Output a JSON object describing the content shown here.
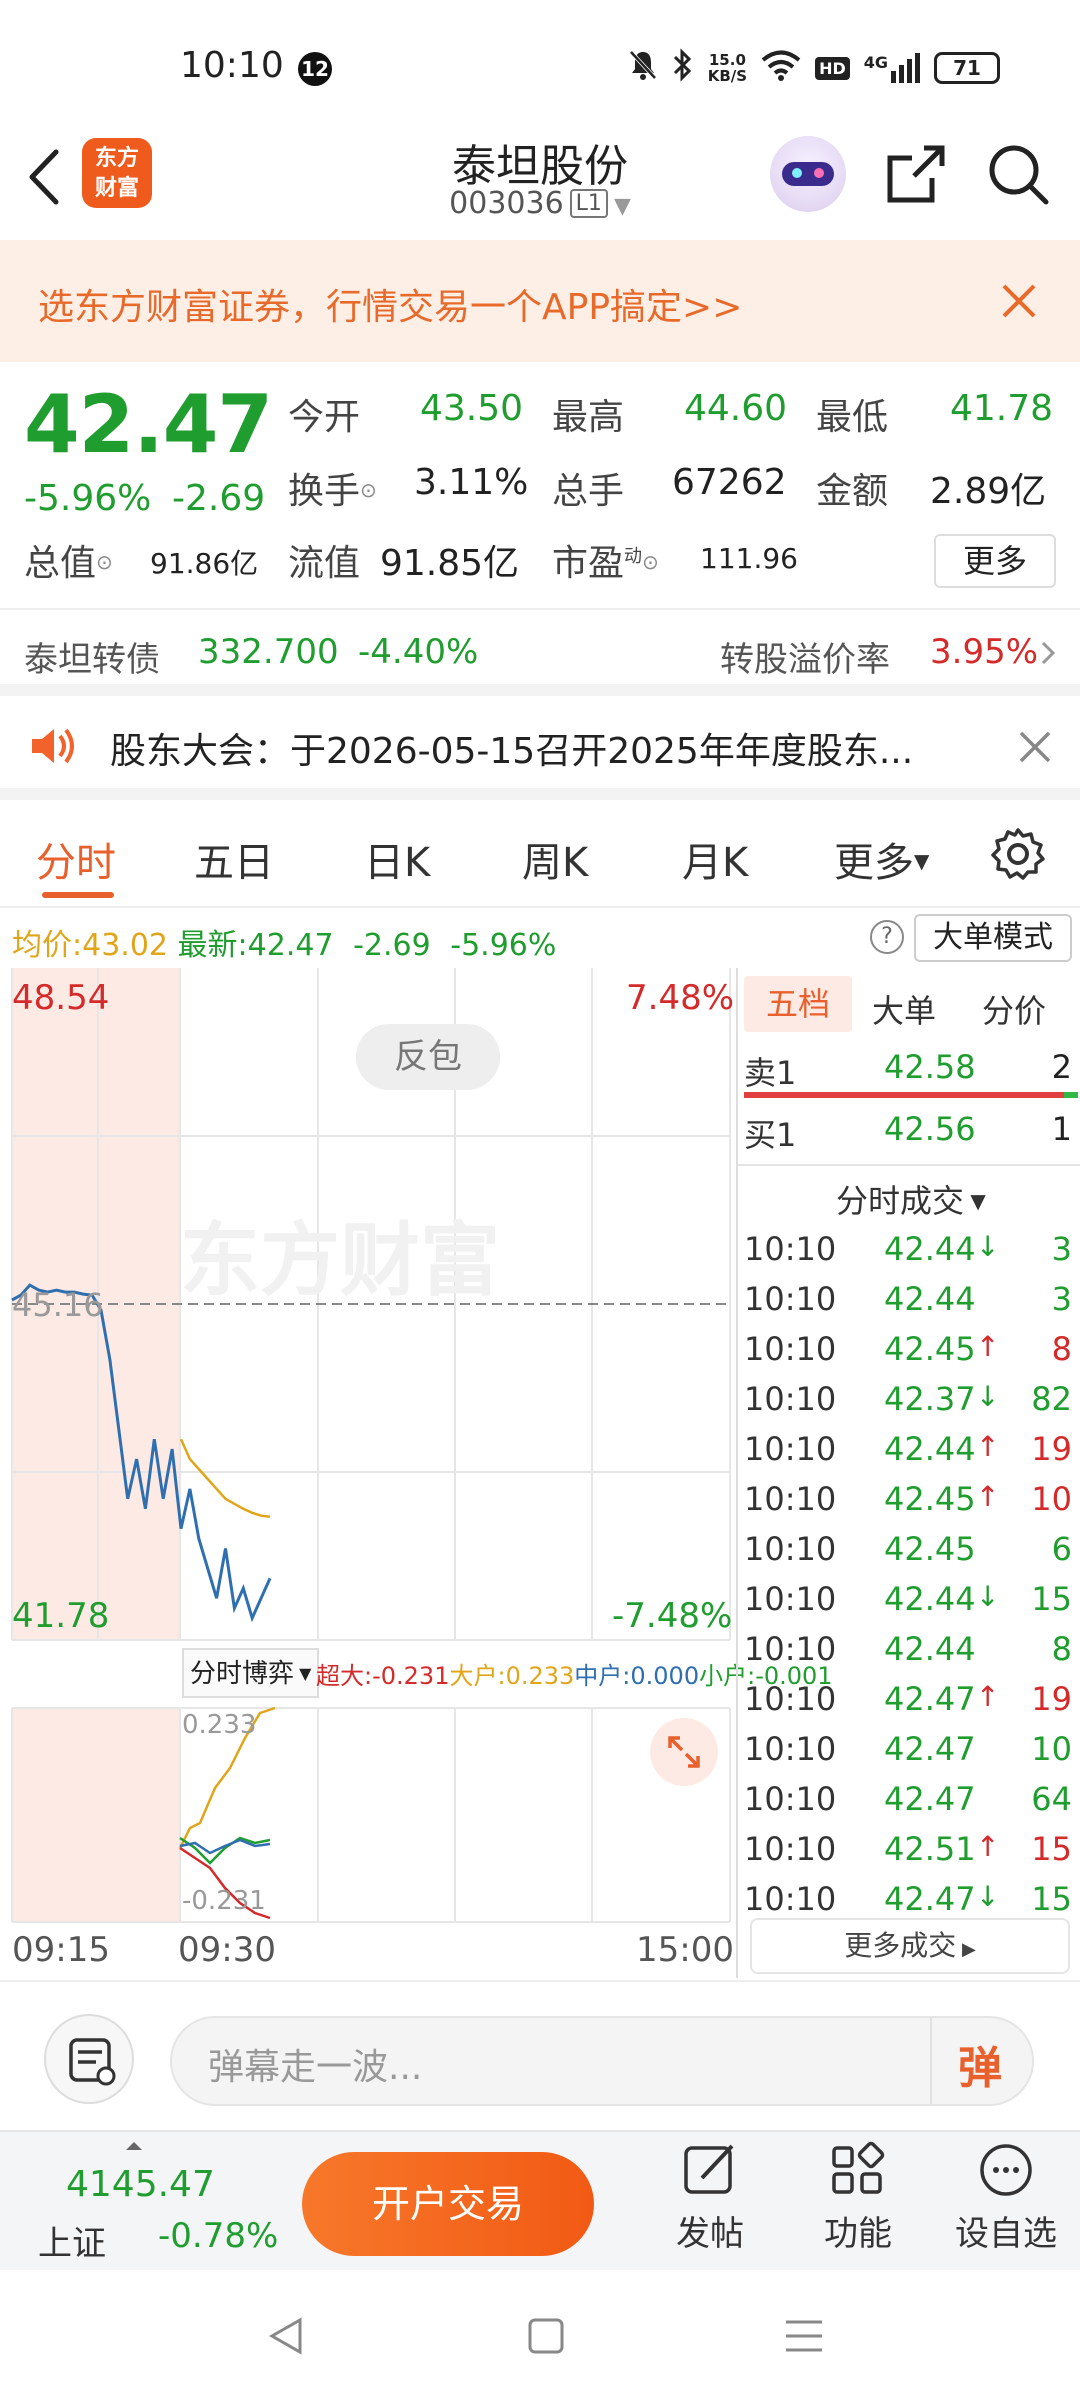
{
  "status_bar": {
    "time": "10:10",
    "notification_count": "12",
    "net_speed_value": "15.0",
    "net_speed_unit": "KB/S",
    "hd": "HD",
    "signal": "4G",
    "battery": "71"
  },
  "header": {
    "logo_text": "东方财富",
    "title": "泰坦股份",
    "code": "003036",
    "code_tag": "L1"
  },
  "banner": {
    "text": "选东方财富证券，行情交易一个APP搞定>>"
  },
  "quote": {
    "price": "42.47",
    "change_pct": "-5.96%",
    "change": "-2.69",
    "open_label": "今开",
    "open": "43.50",
    "high_label": "最高",
    "high": "44.60",
    "low_label": "最低",
    "low": "41.78",
    "turnover_label": "换手",
    "turnover": "3.11%",
    "volume_label": "总手",
    "volume": "67262",
    "amount_label": "金额",
    "amount": "2.89亿",
    "mktcap_label": "总值",
    "mktcap": "91.86亿",
    "float_label": "流值",
    "float": "91.85亿",
    "pe_label": "市盈",
    "pe_sup": "动",
    "pe": "111.96",
    "more_button": "更多"
  },
  "bond": {
    "name": "泰坦转债",
    "price": "332.700",
    "change": "-4.40%",
    "premium_label": "转股溢价率",
    "premium": "3.95%"
  },
  "notice": {
    "text": "股东大会：于2026-05-15召开2025年年度股东..."
  },
  "tabs": [
    "分时",
    "五日",
    "日K",
    "周K",
    "月K",
    "更多"
  ],
  "indicators": {
    "avg_label": "均价:",
    "avg": "43.02",
    "latest_label": "最新:",
    "latest": "42.47",
    "change": "-2.69",
    "change_pct": "-5.96%",
    "mode_button": "大单模式"
  },
  "chart": {
    "top_price": "48.54",
    "mid_price": "45.16",
    "bottom_price": "41.78",
    "top_pct": "7.48%",
    "bottom_pct": "-7.48%",
    "pattern_label": "反包",
    "watermark": "东方财富",
    "time_start": "09:15",
    "time_mid": "09:30",
    "time_end": "15:00"
  },
  "flow": {
    "selector": "分时博弈",
    "super_label": "超大:",
    "super": "-0.231",
    "big_label": "大户:",
    "big": "0.233",
    "mid_label": "中户:",
    "mid": "0.000",
    "small_label": "小户:",
    "small": "-0.001",
    "axis_top": "0.233",
    "axis_bottom": "-0.231"
  },
  "chart_data": {
    "type": "line",
    "series": [
      {
        "name": "",
        "values": [
          45.2,
          45.25,
          45.35,
          45.3,
          45.28,
          45.3,
          45.28,
          45.28,
          45.26,
          45.25,
          45.1,
          44.6,
          43.9,
          43.2,
          43.6,
          43.1,
          43.8,
          43.2,
          43.7,
          42.9,
          43.3,
          42.8,
          42.5,
          42.2,
          42.7,
          42.1,
          42.3,
          42.0,
          42.2,
          42.4
        ]
      },
      {
        "name": "",
        "values": [
          null,
          null,
          null,
          null,
          null,
          null,
          null,
          null,
          null,
          null,
          null,
          null,
          null,
          null,
          null,
          null,
          null,
          null,
          null,
          43.8,
          43.6,
          43.5,
          43.4,
          43.3,
          43.2,
          43.15,
          43.1,
          43.06,
          43.03,
          43.02
        ]
      }
    ],
    "ylim": [
      41.78,
      48.54
    ],
    "x_ticks": [
      "09:15",
      "09:30",
      "15:00"
    ]
  },
  "order_book": {
    "tabs": [
      "五档",
      "大单",
      "分价"
    ],
    "sell": {
      "label": "卖1",
      "price": "42.58",
      "vol": "2"
    },
    "buy": {
      "label": "买1",
      "price": "42.56",
      "vol": "1"
    },
    "ticks_title": "分时成交",
    "ticks": [
      {
        "t": "10:10",
        "p": "42.44",
        "dir": "↓",
        "v": "3"
      },
      {
        "t": "10:10",
        "p": "42.44",
        "dir": "",
        "v": "3"
      },
      {
        "t": "10:10",
        "p": "42.45",
        "dir": "↑",
        "v": "8"
      },
      {
        "t": "10:10",
        "p": "42.37",
        "dir": "↓",
        "v": "82"
      },
      {
        "t": "10:10",
        "p": "42.44",
        "dir": "↑",
        "v": "19"
      },
      {
        "t": "10:10",
        "p": "42.45",
        "dir": "↑",
        "v": "10"
      },
      {
        "t": "10:10",
        "p": "42.45",
        "dir": "",
        "v": "6"
      },
      {
        "t": "10:10",
        "p": "42.44",
        "dir": "↓",
        "v": "15"
      },
      {
        "t": "10:10",
        "p": "42.44",
        "dir": "",
        "v": "8"
      },
      {
        "t": "10:10",
        "p": "42.47",
        "dir": "↑",
        "v": "19"
      },
      {
        "t": "10:10",
        "p": "42.47",
        "dir": "",
        "v": "10"
      },
      {
        "t": "10:10",
        "p": "42.47",
        "dir": "",
        "v": "64"
      },
      {
        "t": "10:10",
        "p": "42.51",
        "dir": "↑",
        "v": "15"
      },
      {
        "t": "10:10",
        "p": "42.47",
        "dir": "↓",
        "v": "15"
      }
    ],
    "more_button": "更多成交"
  },
  "comment": {
    "placeholder": "弹幕走一波...",
    "danmu_button": "弹"
  },
  "bottom_bar": {
    "index_value": "4145.47",
    "index_name": "上证",
    "index_change": "-0.78%",
    "open_account": "开户交易",
    "post": "发帖",
    "function": "功能",
    "watchlist": "设自选"
  }
}
